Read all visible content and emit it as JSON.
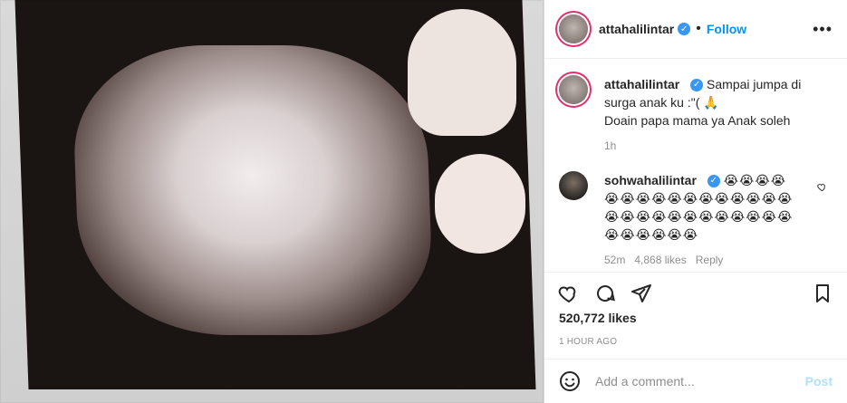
{
  "header": {
    "username": "attahalilintar",
    "separator": "•",
    "follow_label": "Follow",
    "more_label": "•••"
  },
  "caption": {
    "username": "attahalilintar",
    "text_line1": "Sampai jumpa di surga anak ku :\"( 🙏",
    "text_line2": "Doain papa mama ya Anak soleh",
    "time": "1h"
  },
  "comment": {
    "username": "sohwahalilintar",
    "text": "😭😭😭😭😭😭😭😭😭😭😭😭😭😭😭😭😭😭😭😭😭😭😭😭😭😭😭😭😭😭😭😭😭😭",
    "time": "52m",
    "likes": "4,868 likes",
    "reply": "Reply"
  },
  "post": {
    "likes": "520,772 likes",
    "time": "1 HOUR AGO"
  },
  "add_comment": {
    "placeholder": "Add a comment...",
    "post_label": "Post"
  },
  "icons": {
    "heart": "heart-icon",
    "comment": "comment-icon",
    "share": "share-icon",
    "bookmark": "bookmark-icon",
    "emoji": "emoji-icon",
    "verified": "verified-badge-icon"
  },
  "colors": {
    "accent": "#0095f6",
    "post_disabled": "#b2dffc",
    "muted": "#8e8e8e"
  }
}
